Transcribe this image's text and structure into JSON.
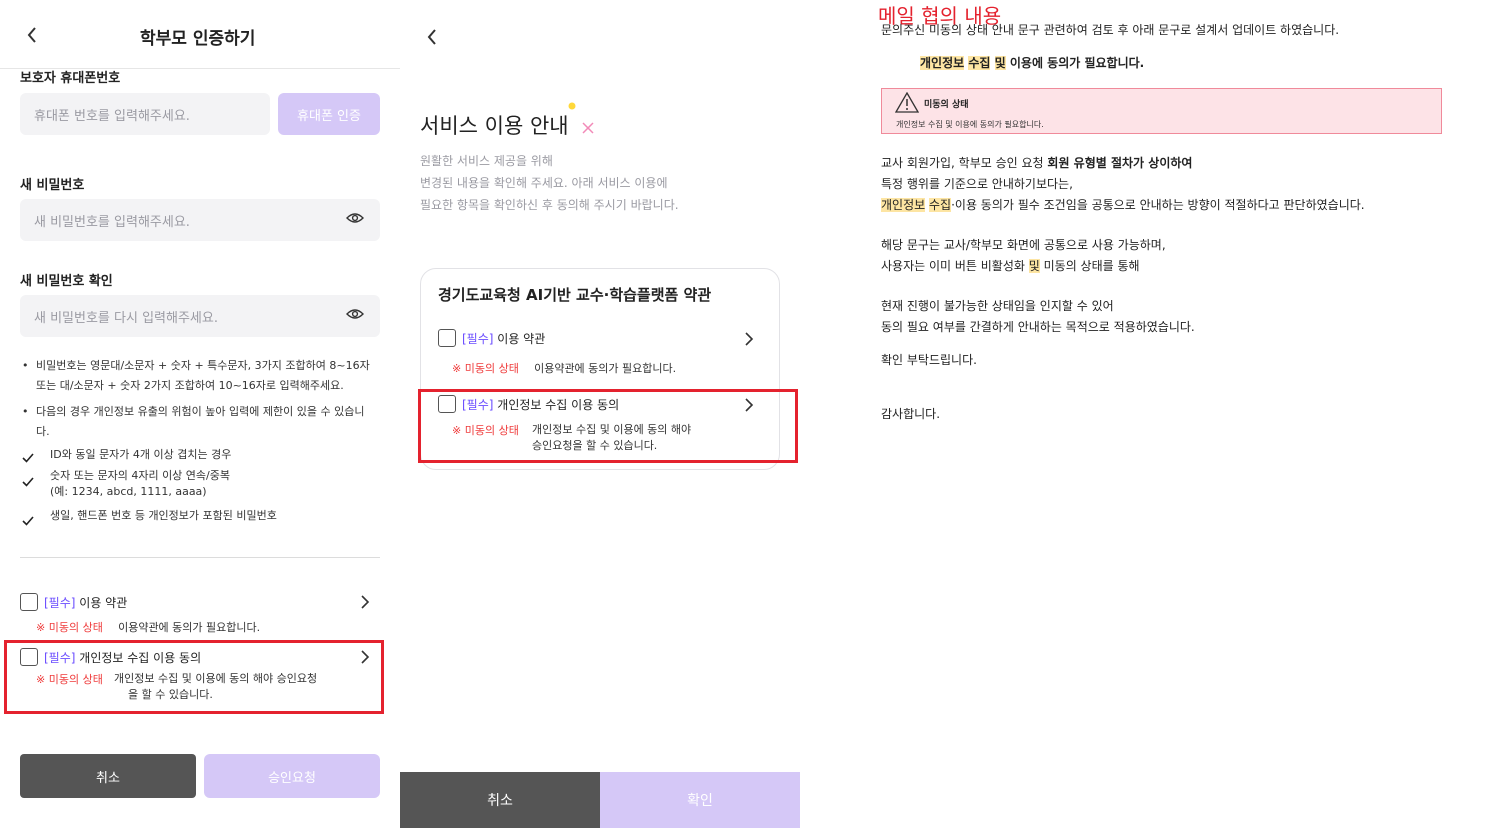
{
  "panel1": {
    "header_title": "학부모 인증하기",
    "phone_label": "보호자 휴대폰번호",
    "phone_placeholder": "휴대폰 번호를 입력해주세요.",
    "phone_verify_button": "휴대폰 인증",
    "new_pw_label": "새 비밀번호",
    "new_pw_placeholder": "새 비밀번호를 입력해주세요.",
    "confirm_pw_label": "새 비밀번호 확인",
    "confirm_pw_placeholder": "새 비밀번호를 다시 입력해주세요.",
    "rule1": "비밀번호는 영문대/소문자 + 숫자 + 특수문자, 3가지 조합하여 8~16자 또는 대/소문자 + 숫자 2가지 조합하여 10~16자로 입력해주세요.",
    "rule2": "다음의 경우 개인정보 유출의 위험이 높아 입력에 제한이 있을 수 있습니다.",
    "check1": "ID와 동일 문자가 4개 이상 겹치는 경우",
    "check2_line1": "숫자 또는 문자의 4자리 이상 연속/중복",
    "check2_line2": "(예: 1234, abcd, 1111, aaaa)",
    "check3": "생일, 핸드폰 번호 등 개인정보가 포함된 비밀번호",
    "required_tag": "[필수]",
    "terms_label": "이용 약관",
    "warn_label": "※ 미동의 상태",
    "terms_warn": "이용약관에 동의가 필요합니다.",
    "privacy_label": "개인정보 수집 이용 동의",
    "privacy_warn_line1": "개인정보 수집 및 이용에 동의 해야 승인요청",
    "privacy_warn_line2": "을 할 수 있습니다.",
    "cancel_button": "취소",
    "approve_button": "승인요청"
  },
  "panel2": {
    "title": "서비스 이용 안내",
    "desc1": "원활한 서비스 제공을 위해",
    "desc2": "변경된 내용을 확인해 주세요. 아래 서비스 이용에",
    "desc3": "필요한 항목을 확인하신 후 동의해 주시기 바랍니다.",
    "card_title": "경기도교육청 AI기반 교수·학습플랫폼 약관",
    "required_tag": "[필수]",
    "terms_label": "이용 약관",
    "warn_label": "※ 미동의 상태",
    "terms_warn": "이용약관에 동의가 필요합니다.",
    "privacy_label": "개인정보 수집 이용 동의",
    "privacy_warn_line1": "개인정보 수집 및 이용에 동의 해야",
    "privacy_warn_line2": "승인요청을 할 수 있습니다.",
    "cancel_button": "취소",
    "confirm_button": "확인"
  },
  "mail": {
    "heading": "메일 협의 내용",
    "intro": "문의주신  미동의 상태 안내 문구 관련하여 검토 후 아래 문구로 설계서 업데이트 하였습니다.",
    "hl_word1": "개인정보",
    "hl_word2": "수집",
    "hl_word3": "및",
    "sentence_rest": "이용에 동의가 필요합니다.",
    "banner_title": "미동의 상태",
    "banner_text": "개인정보 수집 및 이용에 동의가 필요합니다.",
    "p1_a": "교사 회원가입, 학부모 승인 요청 ",
    "p1_b": "회원 유형별 절차가 상이하여",
    "p1_line2": "특정 행위를 기준으로 안내하기보다는,",
    "p1_hl1": "개인정보",
    "p1_hl2": "수집",
    "p1_rest": "·이용 동의가 필수 조건임을 공통으로 안내하는 방향이 적절하다고 판단하였습니다.",
    "p2_line1": "해당 문구는 교사/학부모 화면에 공통으로 사용 가능하며,",
    "p2_line2a": "사용자는 이미 버튼 비활성화 ",
    "p2_line2_hl": "및",
    "p2_line2b": " 미동의 상태를 통해",
    "p3_line1": "현재 진행이 불가능한 상태임을 인지할 수 있어",
    "p3_line2": "동의 필요 여부를 간결하게 안내하는 목적으로 적용하였습니다.",
    "confirm_request": "확인 부탁드립니다.",
    "thanks": "감사합니다."
  }
}
